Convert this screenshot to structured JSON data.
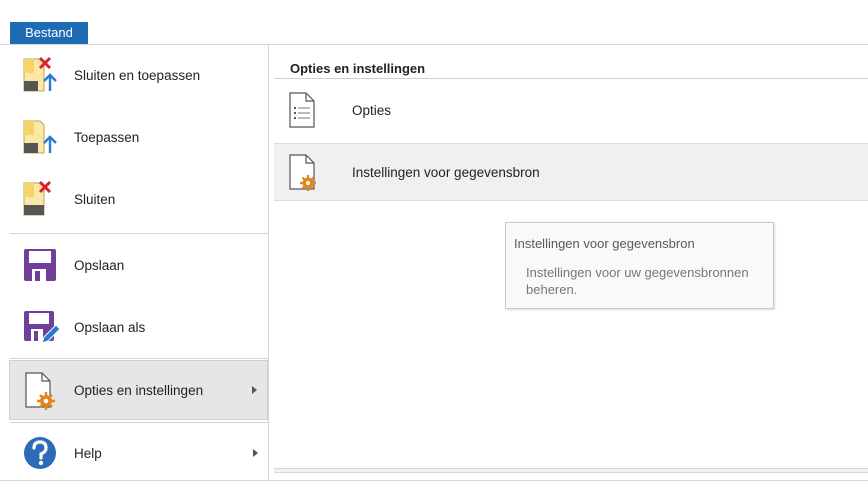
{
  "file_tab": {
    "label": "Bestand"
  },
  "menu": {
    "items": [
      {
        "label": "Sluiten en toepassen",
        "icon": "close-and-apply-icon"
      },
      {
        "label": "Toepassen",
        "icon": "apply-icon"
      },
      {
        "label": "Sluiten",
        "icon": "close-icon"
      },
      {
        "label": "Opslaan",
        "icon": "save-icon"
      },
      {
        "label": "Opslaan als",
        "icon": "save-as-icon"
      },
      {
        "label": "Opties en instellingen",
        "icon": "options-settings-icon"
      },
      {
        "label": "Help",
        "icon": "help-icon"
      }
    ]
  },
  "options_panel": {
    "title": "Opties en instellingen",
    "items": [
      {
        "label": "Opties",
        "icon": "options-doc-icon"
      },
      {
        "label": "Instellingen voor gegevensbron",
        "icon": "data-source-settings-icon"
      }
    ]
  },
  "tooltip": {
    "title": "Instellingen voor gegevensbron",
    "description": "Instellingen voor uw gegevensbronnen beheren."
  },
  "colors": {
    "accent": "#1f6cb4",
    "save_purple": "#6f3f9a",
    "close_red": "#d9232e",
    "apply_blue": "#2a7ad1",
    "gear_orange": "#e0861c",
    "help_blue": "#2d6bb8"
  }
}
